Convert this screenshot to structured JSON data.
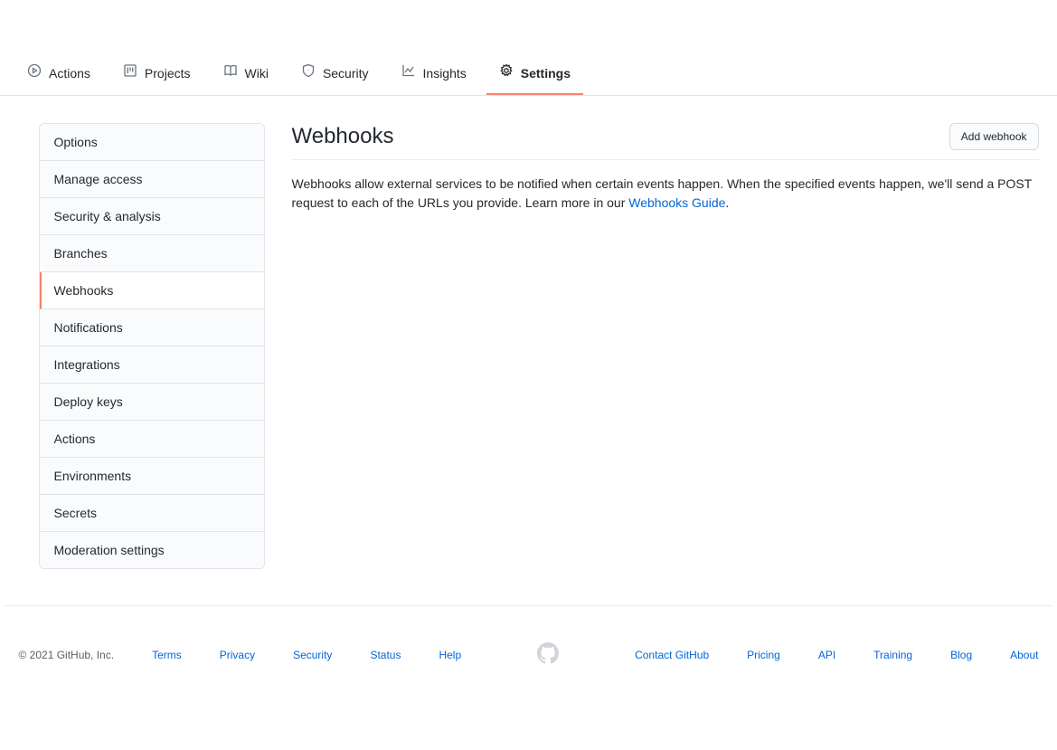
{
  "tabs": {
    "actions": "Actions",
    "projects": "Projects",
    "wiki": "Wiki",
    "security": "Security",
    "insights": "Insights",
    "settings": "Settings"
  },
  "sidebar": {
    "options": "Options",
    "manage_access": "Manage access",
    "security_analysis": "Security & analysis",
    "branches": "Branches",
    "webhooks": "Webhooks",
    "notifications": "Notifications",
    "integrations": "Integrations",
    "deploy_keys": "Deploy keys",
    "actions": "Actions",
    "environments": "Environments",
    "secrets": "Secrets",
    "moderation": "Moderation settings"
  },
  "main": {
    "title": "Webhooks",
    "add_button": "Add webhook",
    "description_prefix": "Webhooks allow external services to be notified when certain events happen. When the specified events happen, we'll send a POST request to each of the URLs you provide. Learn more in our ",
    "guide_link": "Webhooks Guide",
    "description_suffix": "."
  },
  "footer": {
    "copyright": "© 2021 GitHub, Inc.",
    "terms": "Terms",
    "privacy": "Privacy",
    "security": "Security",
    "status": "Status",
    "help": "Help",
    "contact": "Contact GitHub",
    "pricing": "Pricing",
    "api": "API",
    "training": "Training",
    "blog": "Blog",
    "about": "About"
  }
}
